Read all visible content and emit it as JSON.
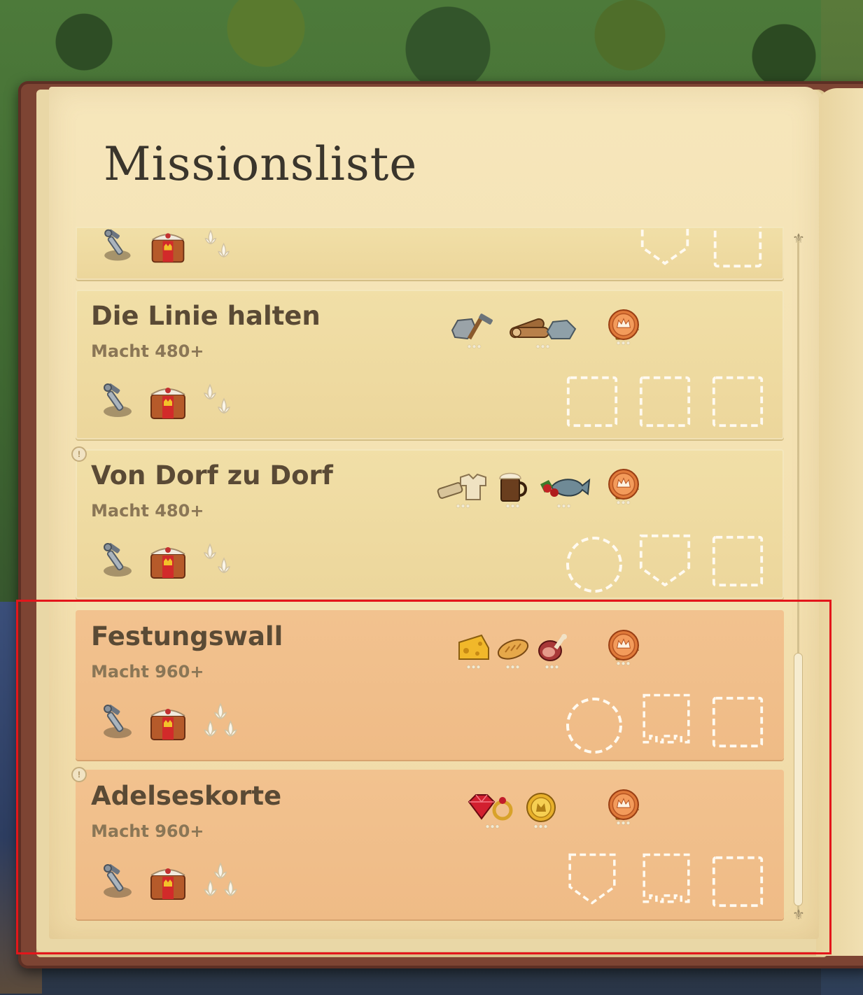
{
  "page": {
    "title": "Missionsliste"
  },
  "missions": [
    {
      "title": "",
      "power": "",
      "partial": true,
      "slots": [
        "shield",
        "square"
      ]
    },
    {
      "title": "Die Linie halten",
      "power": "Macht 480+",
      "resources": [
        "stone-hammer-icon",
        "logs-stone-icon"
      ],
      "slots": [
        "square",
        "square",
        "square"
      ]
    },
    {
      "title": "Von Dorf zu Dorf",
      "power": "Macht 480+",
      "resources": [
        "cloth-shirt-icon",
        "beer-mug-icon",
        "berries-fish-icon"
      ],
      "slots": [
        "circle",
        "shield",
        "square"
      ]
    },
    {
      "title": "Festungswall",
      "power": "Macht 960+",
      "resources": [
        "cheese-icon",
        "bread-icon",
        "ham-icon"
      ],
      "slots": [
        "circle",
        "tower",
        "square"
      ]
    },
    {
      "title": "Adelseskorte",
      "power": "Macht 960+",
      "resources": [
        "ruby-ring-icon",
        "gold-coin-icon"
      ],
      "slots": [
        "shield",
        "tower",
        "square"
      ]
    }
  ],
  "icons": {
    "dagger": "dagger-icon",
    "chest": "royal-chest-icon",
    "lily": "fleur-de-lis-icon",
    "trophy": "trophy-icon",
    "medal": "bronze-crown-medal-icon"
  },
  "colors": {
    "highlight_frame": "#e3161b",
    "card_highlight": "#f2c28f",
    "card_normal": "#f1dfa7"
  }
}
